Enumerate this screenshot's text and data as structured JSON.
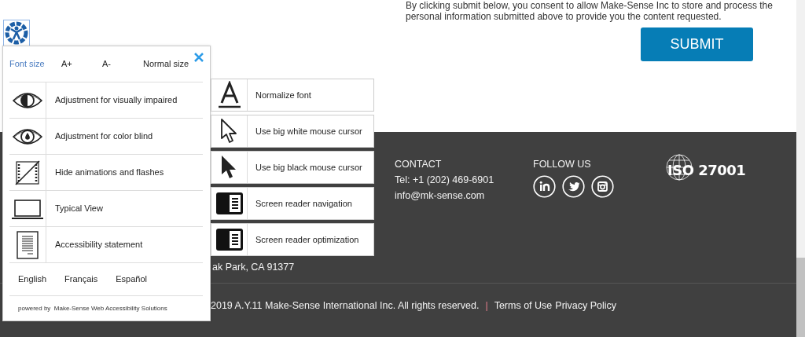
{
  "consent_lines": [
    "By clicking submit below, you consent to allow Make-Sense Inc to store and process the",
    "personal information submitted above to provide you the content requested."
  ],
  "submit_button": "SUBMIT",
  "footer": {
    "address_fragment": "ak Park, CA 91377",
    "contact": {
      "heading": "CONTACT",
      "phone": "Tel: +1 (202) 469-6901",
      "email": "info@mk-sense.com"
    },
    "follow": {
      "heading": "FOLLOW US",
      "social": [
        {
          "kind": "linkedin"
        },
        {
          "kind": "twitter"
        },
        {
          "kind": "instagram"
        }
      ]
    },
    "certification": "ISO 27001",
    "copyright": "2019 A.Y.11 Make-Sense International Inc. All rights reserved.",
    "separator": "|",
    "links": [
      "Terms of Use",
      "Privacy Policy"
    ]
  },
  "accessibility_panel": {
    "font_size_label": "Font size",
    "font_size_options": [
      "A+",
      "A-",
      "Normal size"
    ],
    "items": [
      {
        "kind": "contrast",
        "label": "Adjustment for visually impaired"
      },
      {
        "kind": "colorblind",
        "label": "Adjustment for color blind"
      },
      {
        "kind": "animations",
        "label": "Hide animations and flashes"
      },
      {
        "kind": "typical",
        "label": "Typical View"
      },
      {
        "kind": "statement",
        "label": "Accessibility statement"
      }
    ],
    "languages": [
      "English",
      "Français",
      "Español"
    ],
    "powered_by": "powered by",
    "provider": "Make-Sense Web Accessibility Solutions"
  },
  "options_panel": [
    {
      "kind": "font",
      "label": "Normalize font"
    },
    {
      "kind": "white-cursor",
      "label": "Use big white mouse cursor"
    },
    {
      "kind": "black-cursor",
      "label": "Use big black mouse cursor"
    },
    {
      "kind": "reader",
      "label": "Screen reader navigation"
    },
    {
      "kind": "reader",
      "label": "Screen reader optimization"
    }
  ]
}
